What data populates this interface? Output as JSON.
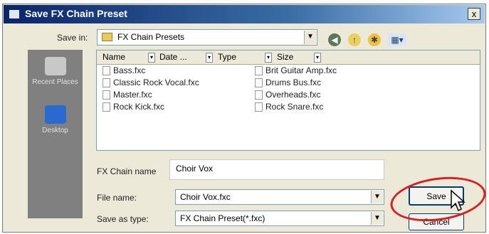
{
  "window": {
    "title": "Save FX Chain Preset",
    "close_label": "x"
  },
  "toolbar": {
    "save_in_label": "Save in:",
    "save_in_value": "FX Chain Presets",
    "icons": [
      "back-icon",
      "up-folder-icon",
      "new-folder-icon",
      "view-menu-icon"
    ]
  },
  "places": [
    {
      "label": "Recent Places",
      "icon": "recent-places-icon"
    },
    {
      "label": "Desktop",
      "icon": "desktop-icon"
    }
  ],
  "file_list": {
    "columns": [
      "Name",
      "Date ...",
      "Type",
      "Size"
    ],
    "files": [
      "Bass.fxc",
      "Classic Rock Vocal.fxc",
      "Master.fxc",
      "Rock Kick.fxc",
      "Brit Guitar Amp.fxc",
      "Drums Bus.fxc",
      "Overheads.fxc",
      "Rock Snare.fxc"
    ]
  },
  "form": {
    "fx_chain_name_label": "FX Chain name",
    "fx_chain_name_value": "Choir Vox",
    "file_name_label": "File name:",
    "file_name_value": "Choir Vox.fxc",
    "save_as_type_label": "Save as type:",
    "save_as_type_value": "FX Chain Preset(*.fxc)"
  },
  "buttons": {
    "save": "Save",
    "cancel": "Cancel"
  },
  "colors": {
    "title_bar": "#0a246a",
    "annotation_ring": "#d92020"
  }
}
